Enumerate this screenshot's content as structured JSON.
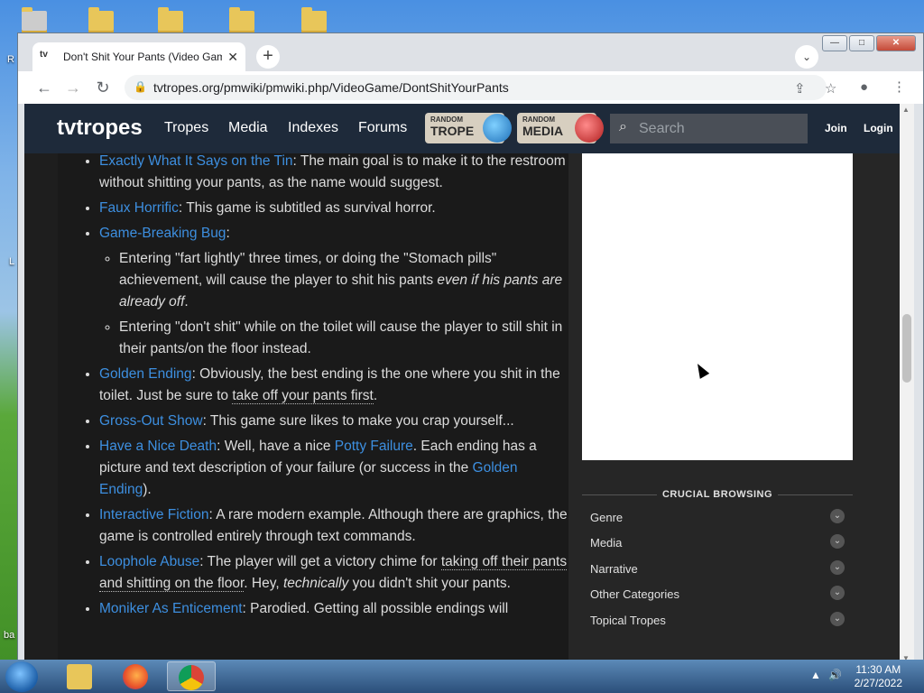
{
  "desktop": {
    "left_edge_labels": [
      "R",
      "L",
      "ba"
    ]
  },
  "browser": {
    "tab_title": "Don't Shit Your Pants (Video Gam",
    "tab_favicon": "tv",
    "url": "tvtropes.org/pmwiki/pmwiki.php/VideoGame/DontShitYourPants",
    "window_buttons": {
      "minimize": "—",
      "maximize": "□",
      "close": "✕"
    }
  },
  "site": {
    "logo_tv": "tv",
    "logo_tropes": "tropes",
    "nav": [
      "Tropes",
      "Media",
      "Indexes",
      "Forums"
    ],
    "random_trope": {
      "top": "RANDOM",
      "main": "TROPE"
    },
    "random_media": {
      "top": "RANDOM",
      "main": "MEDIA"
    },
    "search_placeholder": "Search",
    "join": "Join",
    "login": "Login"
  },
  "article": {
    "items": [
      {
        "link": "Exactly What It Says on the Tin",
        "text": ": The main goal is to make it to the restroom without shitting your pants, as the name would suggest."
      },
      {
        "link": "Faux Horrific",
        "text": ": This game is subtitled as survival horror."
      },
      {
        "link": "Game-Breaking Bug",
        "text": ":"
      },
      {
        "link": "Golden Ending",
        "text": ": Obviously, the best ending is the one where you shit in the toilet. Just be sure to ",
        "u": "take off your pants first",
        "tail": "."
      },
      {
        "link": "Gross-Out Show",
        "text": ": This game sure likes to make you crap yourself..."
      },
      {
        "link": "Have a Nice Death",
        "text": ": Well, have a nice ",
        "link2": "Potty Failure",
        "text2": ". Each ending has a picture and text description of your failure (or success in the ",
        "link3": "Golden Ending",
        "text3": ")."
      },
      {
        "link": "Interactive Fiction",
        "text": ": A rare modern example. Although there are graphics, the game is controlled entirely through text commands."
      },
      {
        "link": "Loophole Abuse",
        "text": ": The player will get a victory chime for ",
        "u": "taking off their pants and shitting on the floor",
        "text2": ". Hey, ",
        "em": "technically",
        "text3": " you didn't shit your pants."
      },
      {
        "link": "Moniker As Enticement",
        "text": ": Parodied. Getting all possible endings will"
      }
    ],
    "sub_items": [
      {
        "text": "Entering \"fart lightly\" three times, or doing the \"Stomach pills\" achievement, will cause the player to shit his pants ",
        "em": "even if his pants are already off",
        "tail": "."
      },
      {
        "text": "Entering \"don't shit\" while on the toilet will cause the player to still shit in their pants/on the floor instead."
      }
    ]
  },
  "sidebar": {
    "crucial_title": "CRUCIAL BROWSING",
    "items": [
      "Genre",
      "Media",
      "Narrative",
      "Other Categories",
      "Topical Tropes"
    ]
  },
  "taskbar": {
    "time": "11:30 AM",
    "date": "2/27/2022"
  }
}
